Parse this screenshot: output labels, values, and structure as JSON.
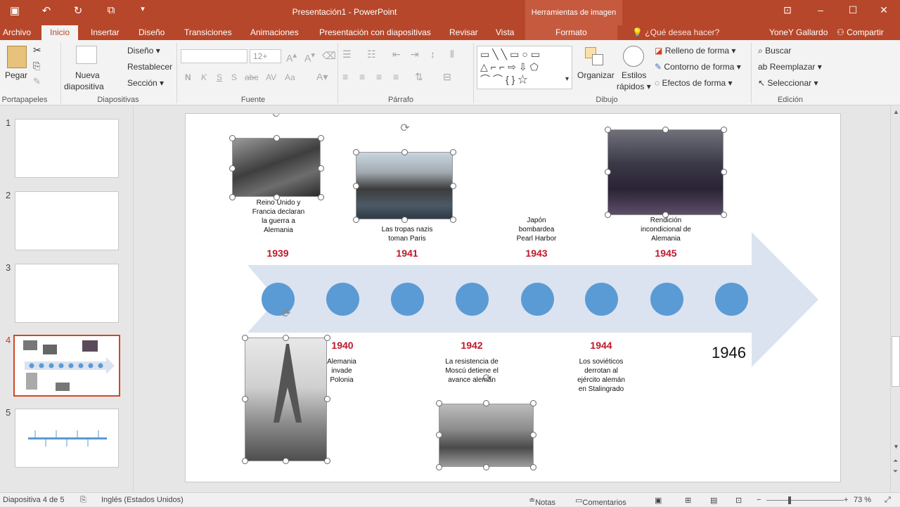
{
  "titlebar": {
    "title": "Presentación1 - PowerPoint",
    "context_header": "Herramientas de imagen"
  },
  "tabs": [
    "Archivo",
    "Inicio",
    "Insertar",
    "Diseño",
    "Transiciones",
    "Animaciones",
    "Presentación con diapositivas",
    "Revisar",
    "Vista",
    "Formato"
  ],
  "tellme": "¿Qué desea hacer?",
  "user": "YoneY Gallardo",
  "share": "Compartir",
  "ribbon": {
    "paste": "Pegar",
    "clipboard_label": "Portapapeles",
    "new_slide_1": "Nueva",
    "new_slide_2": "diapositiva",
    "layout": "Diseño",
    "reset": "Restablecer",
    "section": "Sección",
    "slides_label": "Diapositivas",
    "font_size": "12+",
    "font_label": "Fuente",
    "paragraph_label": "Párrafo",
    "arrange": "Organizar",
    "quick_styles_1": "Estilos",
    "quick_styles_2": "rápidos",
    "shape_fill": "Relleno de forma",
    "shape_outline": "Contorno de forma",
    "shape_effects": "Efectos de forma",
    "drawing_label": "Dibujo",
    "find": "Buscar",
    "replace": "Reemplazar",
    "select": "Seleccionar",
    "editing_label": "Edición"
  },
  "thumbs": [
    {
      "num": "1"
    },
    {
      "num": "2"
    },
    {
      "num": "3"
    },
    {
      "num": "4"
    },
    {
      "num": "5"
    }
  ],
  "slide": {
    "top_events": [
      {
        "year": "1939",
        "text": "Reino Unido y Francia declaran la guerra a Alemania"
      },
      {
        "year": "1941",
        "text": "Las tropas nazis toman Paris"
      },
      {
        "year": "1943",
        "text": "Japón bombardea Pearl Harbor"
      },
      {
        "year": "1945",
        "text": "Rendición incondicional de Alemania"
      }
    ],
    "bottom_events": [
      {
        "year": "1940",
        "text": "Alemania invade Polonia"
      },
      {
        "year": "1942",
        "text": "La resistencia de Moscú detiene el avance alemán"
      },
      {
        "year": "1944",
        "text": "Los soviéticos derrotan al ejército alemán en Stalingrado"
      }
    ],
    "final_year": "1946"
  },
  "status": {
    "slide_info": "Diapositiva 4 de 5",
    "language": "Inglés (Estados Unidos)",
    "notes": "Notas",
    "comments": "Comentarios",
    "zoom": "73 %"
  },
  "colors": {
    "accent": "#b7472a",
    "year_red": "#c0172c",
    "dot_blue": "#5b9bd5",
    "arrow": "#dbe3f1"
  }
}
